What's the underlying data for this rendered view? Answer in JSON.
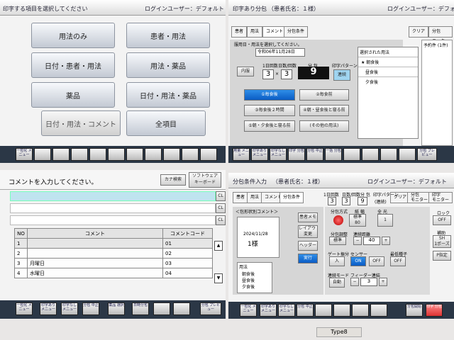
{
  "q1": {
    "header": "印字する項目を選択してください",
    "login": "ログインユーザー：デフォルト",
    "buttons": [
      "用法のみ",
      "患者・用法",
      "日付・患者・用法",
      "用法・薬品",
      "薬品",
      "日付・用法・薬品",
      "日付・用法・コメント",
      "全項目"
    ],
    "footer": [
      "一包化\nメニュー",
      "",
      "",
      "",
      "",
      "",
      "",
      "",
      "",
      "",
      "",
      ""
    ]
  },
  "q2": {
    "title": "印字あり分包",
    "patient": "（患者氏名：１様）",
    "login": "ログインユーザー：デフォルト",
    "tabs": [
      "患者",
      "用法",
      "コメント",
      "分包条件"
    ],
    "right_tabs": [
      "クリア",
      "分包\nモニター"
    ],
    "date_label": "服用日・用法を選択してください。",
    "date_value": "令和06年11月28日",
    "naifuku": "内服",
    "counts": {
      "c1_label": "1日回数",
      "c1": "3",
      "c2_label": "日数/回数",
      "c2": "3",
      "mult": "×",
      "bunpo_label": "分 包",
      "bunpo": "9",
      "pattern_label": "印字パターン",
      "pattern": "連続"
    },
    "usage_options": [
      "①毎食後",
      "②毎食前",
      "③毎食後２時間",
      "④朝・昼食後と寝る前",
      "⑤朝・夕食後と寝る前",
      "(その他の用法)"
    ],
    "selected_title": "選択された用法",
    "selected_items": [
      "★ 朝食後",
      "昼食後",
      "夕食後"
    ],
    "schedule_label": "予約件 (1件)",
    "footer": [
      "用量\nメニュー",
      "印字あり\nメニュー",
      "印字なし\nメニュー",
      "印字\n分包",
      "分包\n中止",
      "一括\n分包",
      "",
      "",
      "",
      "",
      "",
      "分包\nプレビュー"
    ]
  },
  "q3": {
    "prompt": "コメントを入力してください。",
    "kana": "カナ検索",
    "keyboard": "ソフトウェア\nキーボード",
    "cl": "CL",
    "headers": [
      "NO",
      "コメント",
      "コメントコード"
    ],
    "rows": [
      {
        "no": "1",
        "comment": "",
        "code": "01"
      },
      {
        "no": "2",
        "comment": "",
        "code": "02"
      },
      {
        "no": "3",
        "comment": "月曜日",
        "code": "03"
      },
      {
        "no": "4",
        "comment": "水曜日",
        "code": "04"
      }
    ],
    "footer": [
      "一包化\nメニュー",
      "印字あり\nメニュー",
      "印字なし\nメニュー",
      "分包\n中止",
      "薬品\n選択",
      "日時分包",
      "",
      "",
      "",
      "",
      "",
      "分包\nプレビュー"
    ]
  },
  "q4": {
    "title": "分包条件入力",
    "patient": "（患者氏名：１様）",
    "login": "ログインユーザー：デフォルト",
    "tabs": [
      "患者",
      "用法",
      "コメント",
      "分包条件"
    ],
    "top_right": [
      "クリア",
      "分包\nモニター",
      "印字\nモニター",
      "分包\n中止"
    ],
    "preview_label": "＜包形状別コメント＞",
    "preview_date": "2024/11/28",
    "preview_name": "1様",
    "side_btns": [
      "患者メモ",
      "レイアウト\n変更",
      "ヘッダー",
      "実行"
    ],
    "usage_head": "用法",
    "usage_list": [
      "朝食後",
      "昼食後",
      "夕食後"
    ],
    "counts": {
      "c1_label": "1日回数",
      "c1": "3",
      "c2_label": "日数/回数",
      "c2": "3",
      "bunpo_label": "分 包",
      "bunpo": "9",
      "pattern_label": "印字パターン",
      "pattern": "(連続)"
    },
    "group": {
      "method": "分包方式",
      "paper": "紙 幅",
      "paper_val": "標準\n80",
      "width": "全 光",
      "width_val": "1",
      "fold": "分包調整",
      "fold_val": "標準",
      "cut": "連続距離",
      "cut_val": "40",
      "gate": "ゲート振分",
      "gate_val": "入",
      "sensor": "センサー",
      "sensor_val": "ON",
      "sensor_val2": "OFF",
      "seal": "最低種子",
      "seal_val": "OFF",
      "mode": "連続モード",
      "mode_val": "自動",
      "feeder": "フィーダー連結",
      "feeder_val": "3",
      "lock": "ロック",
      "lock_val": "OFF",
      "aux": "補助",
      "aux_val": "SH\n1ポーズ",
      "p": "P指定"
    },
    "footer": [
      "一包化\nメニュー",
      "印字あり\nメニュー",
      "印字なし\nメニュー",
      "分包\n中止",
      "",
      "",
      "",
      "",
      "",
      "",
      "分包開始",
      "印字\n分包"
    ]
  },
  "sticker": "Type8"
}
